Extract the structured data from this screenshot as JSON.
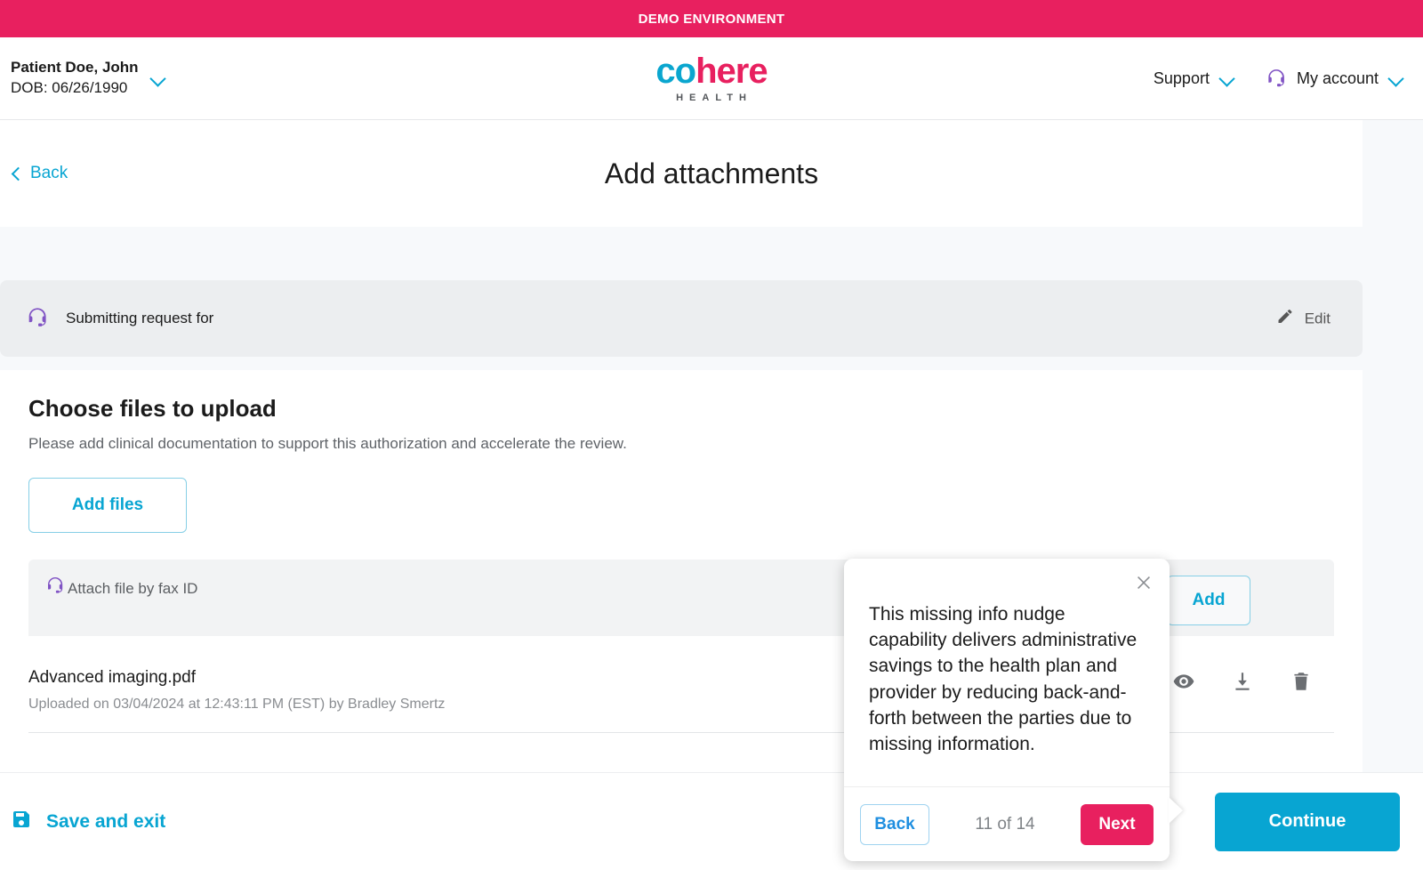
{
  "banner": {
    "text": "DEMO ENVIRONMENT"
  },
  "header": {
    "patient_name": "Patient Doe, John",
    "patient_dob": "DOB: 06/26/1990",
    "logo": {
      "part1": "co",
      "part2": "here",
      "sub": "HEALTH"
    },
    "support_label": "Support",
    "account_label": "My account"
  },
  "titlebar": {
    "back_label": "Back",
    "title": "Add attachments"
  },
  "submitting": {
    "label": "Submitting request for",
    "edit_label": "Edit"
  },
  "upload": {
    "heading": "Choose files to upload",
    "subtext": "Please add clinical documentation to support this authorization and accelerate the review.",
    "add_files_label": "Add files",
    "fax_label": "Attach file by fax ID",
    "fax_value": "",
    "fax_placeholder": "",
    "add_label": "Add"
  },
  "files": [
    {
      "name": "Advanced imaging.pdf",
      "meta": "Uploaded on 03/04/2024 at 12:43:11 PM (EST) by Bradley Smertz"
    }
  ],
  "footer": {
    "save_label": "Save and exit",
    "continue_label": "Continue"
  },
  "nudge": {
    "text": "This missing info nudge capability delivers administrative savings to the health plan and provider by reducing back-and-forth between the parties due to missing information.",
    "back_label": "Back",
    "count_label": "11 of 14",
    "next_label": "Next"
  },
  "colors": {
    "pink": "#e8205f",
    "teal": "#08a5d2",
    "purple": "#8053c4",
    "gray_banner": "#eceef0",
    "page_bg": "#f7f9fb"
  }
}
